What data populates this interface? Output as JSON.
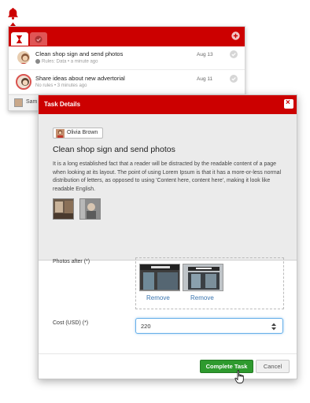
{
  "notifications": {
    "items": [
      {
        "title": "Clean shop sign and send photos",
        "subtitle": "Rules: Data • a minute ago",
        "date": "Aug 13",
        "avatar": "user-avatar"
      },
      {
        "title": "Share ideas about new advertorial",
        "subtitle": "No rules • 3 minutes ago",
        "date": "Aug 11",
        "avatar": "user-avatar"
      }
    ],
    "footer_text": "Sam",
    "tabs": [
      "hourglass-icon",
      "check-icon"
    ]
  },
  "modal": {
    "title": "Task Details",
    "close_icon": "close-icon",
    "assignee": "Olivia Brown",
    "task_title": "Clean shop sign and send photos",
    "description": "It is a long established fact that a reader will be distracted by the readable content of a page when looking at its layout. The point of using Lorem Ipsum is that it has a more-or-less normal distribution of letters, as opposed to using 'Content here, content here', making it look like readable English.",
    "photos_label": "Photos after",
    "photos_required": "(*)",
    "remove_label": "Remove",
    "cost_label": "Cost (USD)",
    "cost_required": "(*)",
    "cost_value": "220",
    "complete_label": "Complete Task",
    "cancel_label": "Cancel"
  },
  "colors": {
    "brand_red": "#cc0000",
    "success_green": "#2e9a2e",
    "link_blue": "#3a75b0",
    "focus_blue": "#66afe9"
  }
}
